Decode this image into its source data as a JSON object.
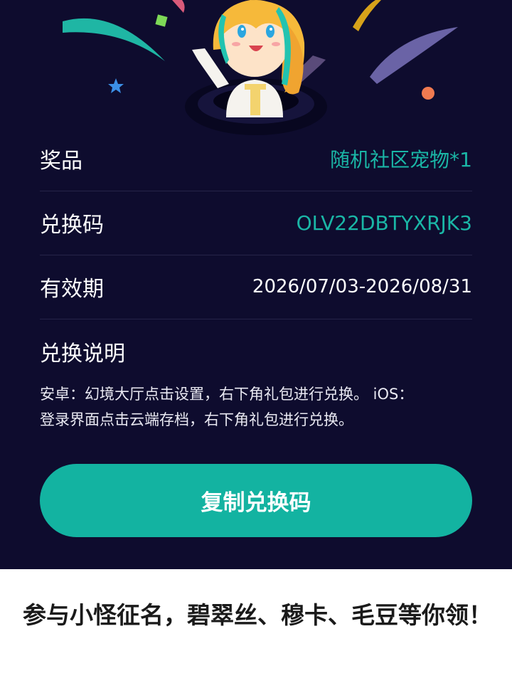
{
  "colors": {
    "background": "#0e0c2e",
    "accent": "#13b3a1",
    "accent_text": "#1ab6a6",
    "divider": "#262449"
  },
  "hero": {
    "icons": [
      "mascot-character",
      "confetti-ribbon",
      "star",
      "square-confetti",
      "orange-dot"
    ]
  },
  "prize": {
    "label": "奖品",
    "value": "随机社区宠物*1"
  },
  "code": {
    "label": "兑换码",
    "value": "OLV22DBTYXRJK3"
  },
  "validity": {
    "label": "有效期",
    "value": "2026/07/03-2026/08/31"
  },
  "instructions": {
    "title": "兑换说明",
    "line1": "安卓：幻境大厅点击设置，右下角礼包进行兑换。 iOS：",
    "line2": "登录界面点击云端存档，右下角礼包进行兑换。"
  },
  "copy_button": {
    "label": "复制兑换码"
  },
  "article": {
    "title": "参与小怪征名，碧翠丝、穆卡、毛豆等你领！"
  }
}
